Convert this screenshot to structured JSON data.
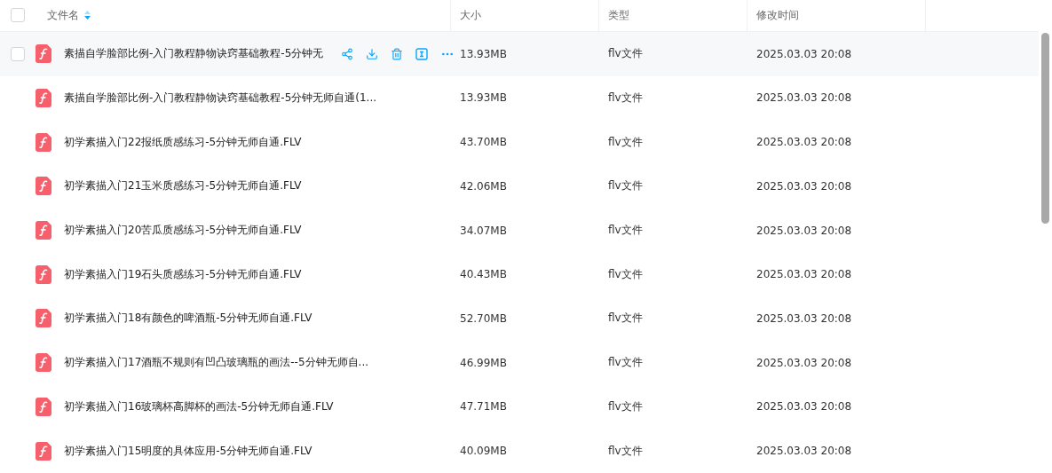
{
  "table": {
    "select_all": {
      "checked": false
    },
    "columns": [
      {
        "label": "文件名",
        "sortable": true
      },
      {
        "label": "大小",
        "sortable": false
      },
      {
        "label": "类型",
        "sortable": false
      },
      {
        "label": "修改时间",
        "sortable": false
      }
    ],
    "rows": [
      {
        "name": "素描自学脸部比例-入门教程静物诀窍基础教程-5分钟无",
        "size": "13.93MB",
        "type": "flv文件",
        "modified": "2025.03.03 20:08",
        "hovered": true
      },
      {
        "name": "素描自学脸部比例-入门教程静物诀窍基础教程-5分钟无师自通(1...",
        "size": "13.93MB",
        "type": "flv文件",
        "modified": "2025.03.03 20:08",
        "hovered": false
      },
      {
        "name": "初学素描入门22报纸质感练习-5分钟无师自通.FLV",
        "size": "43.70MB",
        "type": "flv文件",
        "modified": "2025.03.03 20:08",
        "hovered": false
      },
      {
        "name": "初学素描入门21玉米质感练习-5分钟无师自通.FLV",
        "size": "42.06MB",
        "type": "flv文件",
        "modified": "2025.03.03 20:08",
        "hovered": false
      },
      {
        "name": "初学素描入门20苦瓜质感练习-5分钟无师自通.FLV",
        "size": "34.07MB",
        "type": "flv文件",
        "modified": "2025.03.03 20:08",
        "hovered": false
      },
      {
        "name": "初学素描入门19石头质感练习-5分钟无师自通.FLV",
        "size": "40.43MB",
        "type": "flv文件",
        "modified": "2025.03.03 20:08",
        "hovered": false
      },
      {
        "name": "初学素描入门18有颜色的啤酒瓶-5分钟无师自通.FLV",
        "size": "52.70MB",
        "type": "flv文件",
        "modified": "2025.03.03 20:08",
        "hovered": false
      },
      {
        "name": "初学素描入门17酒瓶不规则有凹凸玻璃瓶的画法--5分钟无师自...",
        "size": "46.99MB",
        "type": "flv文件",
        "modified": "2025.03.03 20:08",
        "hovered": false
      },
      {
        "name": "初学素描入门16玻璃杯高脚杯的画法-5分钟无师自通.FLV",
        "size": "47.71MB",
        "type": "flv文件",
        "modified": "2025.03.03 20:08",
        "hovered": false
      },
      {
        "name": "初学素描入门15明度的具体应用-5分钟无师自通.FLV",
        "size": "40.09MB",
        "type": "flv文件",
        "modified": "2025.03.03 20:08",
        "hovered": false
      }
    ]
  }
}
